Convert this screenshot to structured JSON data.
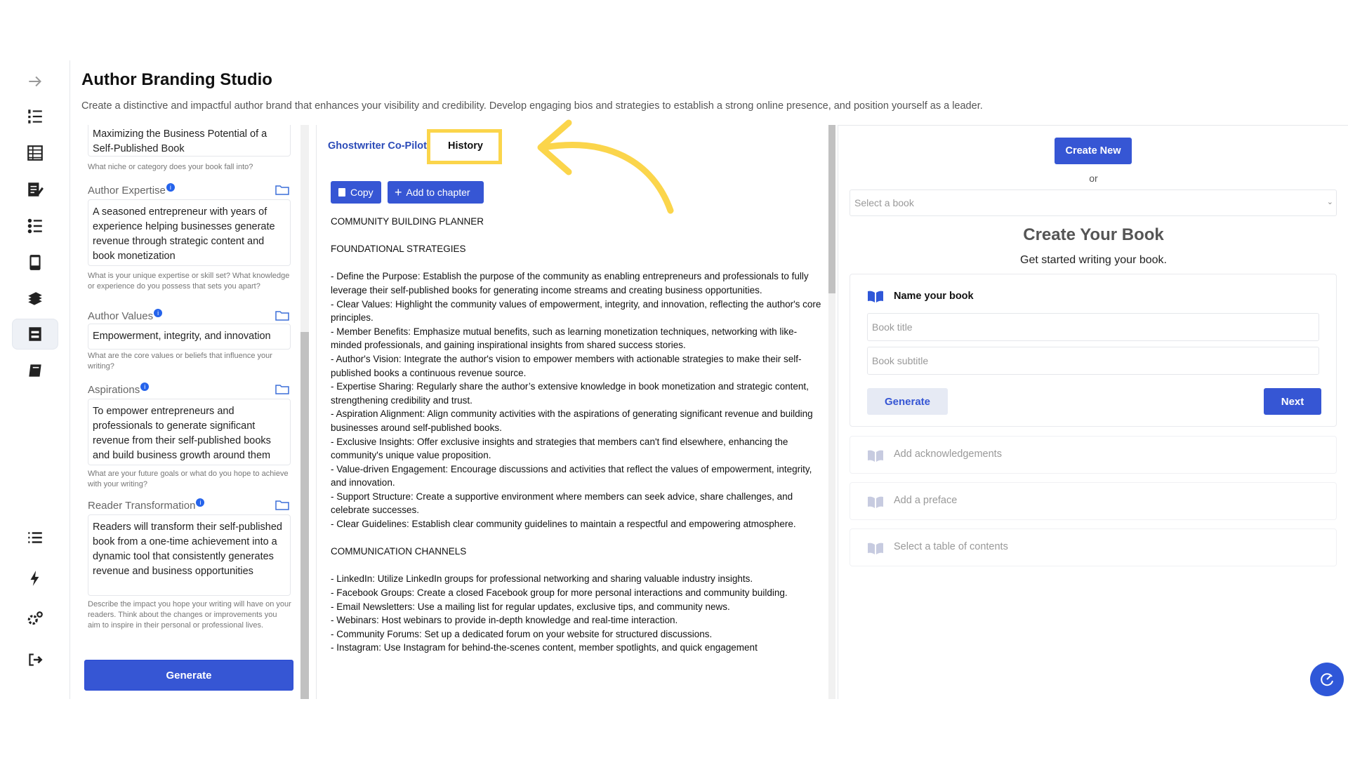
{
  "header": {
    "title": "Author Branding Studio",
    "description": "Create a distinctive and impactful author brand that enhances your visibility and credibility. Develop engaging bios and strategies to establish a strong online presence, and position yourself as a leader."
  },
  "sidebar": {
    "items": [
      "arrow-right-icon",
      "list-numbered-icon",
      "table-icon",
      "edit-doc-icon",
      "checklist-icon",
      "book-device-icon",
      "books-stack-icon",
      "branding-icon",
      "book-icon",
      "list-icon",
      "bolt-icon",
      "settings-icon",
      "logout-icon"
    ]
  },
  "form": {
    "niche_value": "Maximizing the Business Potential of a Self-Published Book",
    "niche_helper": "What niche or category does your book fall into?",
    "expertise_label": "Author Expertise",
    "expertise_value": "A seasoned entrepreneur with years of experience helping businesses generate revenue through strategic content and book monetization",
    "expertise_helper": "What is your unique expertise or skill set? What knowledge or experience do you possess that sets you apart?",
    "values_label": "Author Values",
    "values_value": "Empowerment, integrity, and innovation",
    "values_helper": "What are the core values or beliefs that influence your writing?",
    "aspirations_label": "Aspirations",
    "aspirations_value": "To empower entrepreneurs and professionals to generate significant revenue from their self-published books and build business growth around them",
    "aspirations_helper": "What are your future goals or what do you hope to achieve with your writing?",
    "transformation_label": "Reader Transformation",
    "transformation_value": "Readers will transform their self-published book from a one-time achievement into a dynamic tool that consistently generates revenue and business opportunities",
    "transformation_helper": "Describe the impact you hope your writing will have on your readers. Think about the changes or improvements you aim to inspire in their personal or professional lives.",
    "generate_label": "Generate"
  },
  "middle": {
    "tab_copilot": "Ghostwriter Co-Pilot",
    "tab_history": "History",
    "copy_label": "Copy",
    "add_chapter_label": "Add to chapter",
    "paragraphs": [
      "COMMUNITY BUILDING PLANNER",
      "FOUNDATIONAL STRATEGIES",
      "- Define the Purpose: Establish the purpose of the community as enabling entrepreneurs and professionals to fully leverage their self-published books for generating income streams and creating business opportunities.\n- Clear Values: Highlight the community values of empowerment, integrity, and innovation, reflecting the author's core principles.\n- Member Benefits: Emphasize mutual benefits, such as learning monetization techniques, networking with like-minded professionals, and gaining inspirational insights from shared success stories.\n- Author's Vision: Integrate the author's vision to empower members with actionable strategies to make their self-published books a continuous revenue source.\n- Expertise Sharing: Regularly share the author’s extensive knowledge in book monetization and strategic content, strengthening credibility and trust.\n- Aspiration Alignment: Align community activities with the aspirations of generating significant revenue and building businesses around self-published books.\n- Exclusive Insights: Offer exclusive insights and strategies that members can't find elsewhere, enhancing the community's unique value proposition.\n- Value-driven Engagement: Encourage discussions and activities that reflect the values of empowerment, integrity, and innovation.\n- Support Structure: Create a supportive environment where members can seek advice, share challenges, and celebrate successes.\n- Clear Guidelines: Establish clear community guidelines to maintain a respectful and empowering atmosphere.",
      "COMMUNICATION CHANNELS",
      "- LinkedIn: Utilize LinkedIn groups for professional networking and sharing valuable industry insights.\n- Facebook Groups: Create a closed Facebook group for more personal interactions and community building.\n- Email Newsletters: Use a mailing list for regular updates, exclusive tips, and community news.\n- Webinars: Host webinars to provide in-depth knowledge and real-time interaction.\n- Community Forums: Set up a dedicated forum on your website for structured discussions.\n- Instagram: Use Instagram for behind-the-scenes content, member spotlights, and quick engagement"
    ]
  },
  "right": {
    "create_new_label": "Create New",
    "or_text": "or",
    "select_placeholder": "Select a book",
    "title": "Create Your Book",
    "subtitle": "Get started writing your book.",
    "name_book_label": "Name your book",
    "book_title_placeholder": "Book title",
    "book_subtitle_placeholder": "Book subtitle",
    "generate_label": "Generate",
    "next_label": "Next",
    "steps": [
      "Add acknowledgements",
      "Add a preface",
      "Select a table of contents"
    ]
  },
  "colors": {
    "accent": "#3656d4",
    "highlight": "#fbd54b"
  }
}
